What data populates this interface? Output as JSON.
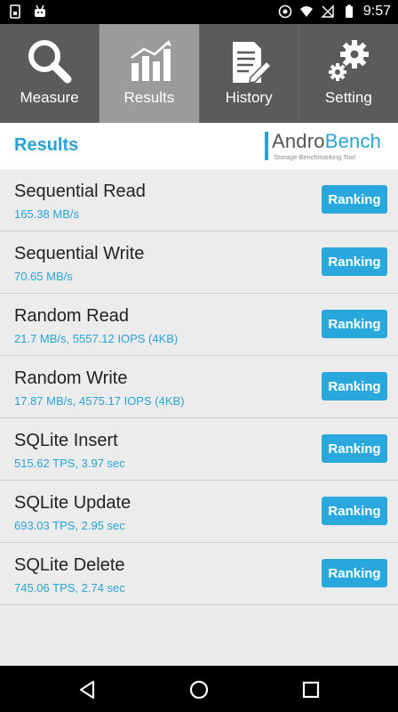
{
  "status_bar": {
    "time": "9:57",
    "icons": [
      "sim-card-icon",
      "android-icon",
      "sync-icon",
      "wifi-icon",
      "no-signal-icon",
      "battery-icon"
    ]
  },
  "tabs": [
    {
      "label": "Measure",
      "icon": "magnifier-icon",
      "active": false
    },
    {
      "label": "Results",
      "icon": "bar-chart-icon",
      "active": true
    },
    {
      "label": "History",
      "icon": "document-edit-icon",
      "active": false
    },
    {
      "label": "Setting",
      "icon": "gears-icon",
      "active": false
    }
  ],
  "header": {
    "title": "Results",
    "logo_prefix": "Andro",
    "logo_suffix": "Bench",
    "logo_tagline": "Storage Benchmarking Tool"
  },
  "results": [
    {
      "name": "Sequential Read",
      "value": "165.38 MB/s",
      "button": "Ranking"
    },
    {
      "name": "Sequential Write",
      "value": "70.65 MB/s",
      "button": "Ranking"
    },
    {
      "name": "Random Read",
      "value": "21.7 MB/s, 5557.12 IOPS (4KB)",
      "button": "Ranking"
    },
    {
      "name": "Random Write",
      "value": "17.87 MB/s, 4575.17 IOPS (4KB)",
      "button": "Ranking"
    },
    {
      "name": "SQLite Insert",
      "value": "515.62 TPS, 3.97 sec",
      "button": "Ranking"
    },
    {
      "name": "SQLite Update",
      "value": "693.03 TPS, 2.95 sec",
      "button": "Ranking"
    },
    {
      "name": "SQLite Delete",
      "value": "745.06 TPS, 2.74 sec",
      "button": "Ranking"
    }
  ],
  "nav_bar": {
    "icons": [
      "back-icon",
      "home-icon",
      "recents-icon"
    ]
  },
  "colors": {
    "accent": "#29a8de",
    "tab_bar": "#5b5b5b",
    "tab_active": "#9b9b9b"
  }
}
